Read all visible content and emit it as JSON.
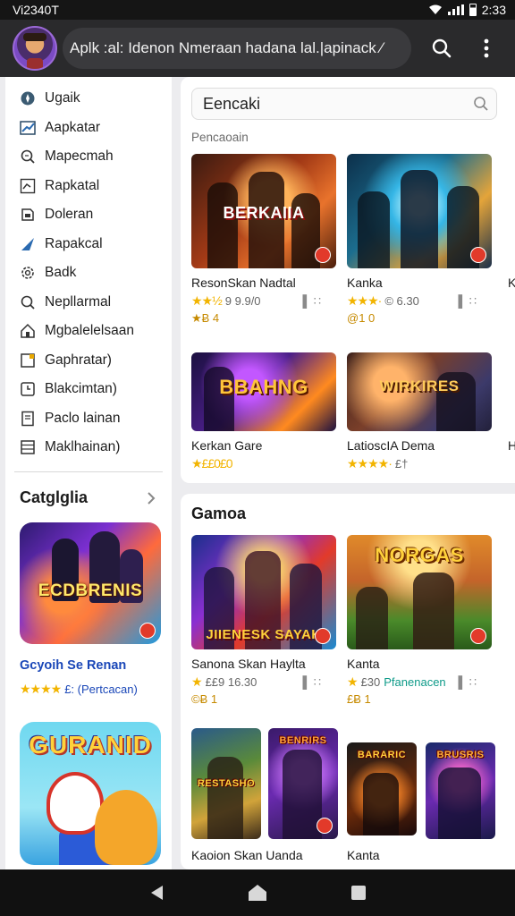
{
  "status_bar": {
    "time_left": "Vi2340T",
    "time_right": "2:33"
  },
  "app_bar": {
    "title": "Aplk :al: Idenon Nmeraan hadana lal.|apinack ⁄"
  },
  "sidebar": {
    "items": [
      {
        "label": "Ugaik",
        "icon": "compass-icon"
      },
      {
        "label": "Aapkatar",
        "icon": "trending-icon"
      },
      {
        "label": "Mapecmah",
        "icon": "search-list-icon"
      },
      {
        "label": "Rapkatal",
        "icon": "chart-icon"
      },
      {
        "label": "Doleran",
        "icon": "bookmark-icon"
      },
      {
        "label": "Rapakcal",
        "icon": "send-icon"
      },
      {
        "label": "Badk",
        "icon": "gear-icon"
      },
      {
        "label": "Nepllarmal",
        "icon": "search-icon"
      },
      {
        "label": "Mgbalelelsaan",
        "icon": "home-icon"
      },
      {
        "label": "Gaphratar)",
        "icon": "square-icon"
      },
      {
        "label": "Blakcimtan)",
        "icon": "clock-icon"
      },
      {
        "label": "Paclo lainan",
        "icon": "document-icon"
      },
      {
        "label": "Maklhainan)",
        "icon": "grid-icon"
      }
    ],
    "category_title": "Catglglia",
    "featured": [
      {
        "logo": "ECDBRENIS",
        "title": "Gcyoih Se Renan",
        "stars": "★★★★",
        "sub": "£: (Pertcacan)"
      },
      {
        "logo": "GURANID"
      }
    ]
  },
  "top_panel": {
    "search_placeholder": "Eencaki",
    "section_label": "Pencaoain",
    "row1": [
      {
        "logo": "BERKAIIA",
        "name": "ResonSkan Nadtal",
        "stars": "★★½",
        "value": "9 9.9/0",
        "tail": "▌∷",
        "meta2": "★Ƀ 4"
      },
      {
        "logo": "",
        "name": "Kanka",
        "stars": "★★★·",
        "value": "© 6.30",
        "tail": "▌∷",
        "meta2": "@1 0"
      },
      {
        "name": "K"
      }
    ],
    "row2": [
      {
        "logo": "BBAHNG",
        "name": "Kerkan Gare",
        "stars": "",
        "value": "★££0£0",
        "tail": ""
      },
      {
        "logo": "WIRKIRES",
        "name": "LatioscIA Dema",
        "stars": "★★★★·",
        "value": "£†",
        "tail": ""
      },
      {
        "name": "H"
      }
    ]
  },
  "games_panel": {
    "title": "Gamoa",
    "row1": [
      {
        "logo": "JIIENESK SAYAK",
        "name": "Sanona Skan Haylta",
        "stars": "★",
        "value": "££9 16.30",
        "tail": "▌∷",
        "meta2": "©Ƀ 1"
      },
      {
        "logo": "NORGAS",
        "name": "Kanta",
        "stars": "★",
        "value": "£30",
        "green": "Pfanenacen",
        "tail": "▌∷",
        "meta2": "£Ƀ 1"
      }
    ],
    "row2": [
      {
        "logo": "RESTASHO",
        "name": "Kaoion Skan Uanda"
      },
      {
        "logo": "BENRIRS"
      },
      {
        "logo": "BARARIC",
        "name": "Kanta"
      },
      {
        "logo": "BRUSRIS"
      }
    ]
  },
  "colors": {
    "accent": "#f2b400",
    "link": "#1a47b8",
    "badge": "#e23a2a",
    "appbar": "#2a2a2c"
  }
}
